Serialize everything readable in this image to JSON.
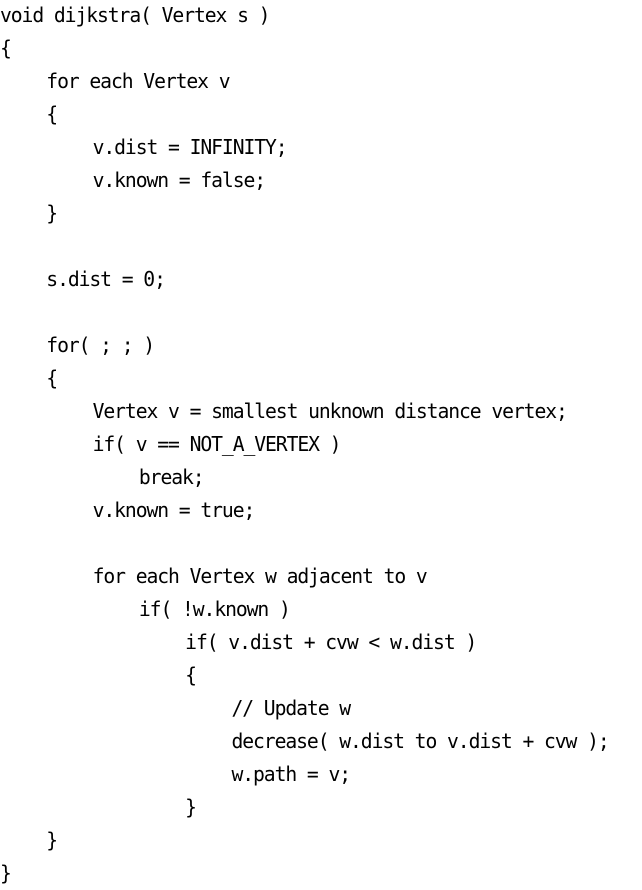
{
  "code": {
    "lines": [
      {
        "indent": 0,
        "text": "void dijkstra( Vertex s )"
      },
      {
        "indent": 0,
        "text": "{"
      },
      {
        "indent": 1,
        "text": "for each Vertex v"
      },
      {
        "indent": 1,
        "text": "{"
      },
      {
        "indent": 2,
        "text": "v.dist = INFINITY;"
      },
      {
        "indent": 2,
        "text": "v.known = false;"
      },
      {
        "indent": 1,
        "text": "}"
      },
      {
        "indent": 0,
        "text": ""
      },
      {
        "indent": 1,
        "text": "s.dist = 0;"
      },
      {
        "indent": 0,
        "text": ""
      },
      {
        "indent": 1,
        "text": "for( ; ; )"
      },
      {
        "indent": 1,
        "text": "{"
      },
      {
        "indent": 2,
        "text": "Vertex v = smallest unknown distance vertex;"
      },
      {
        "indent": 2,
        "text": "if( v == NOT_A_VERTEX )"
      },
      {
        "indent": 3,
        "text": "break;"
      },
      {
        "indent": 2,
        "text": "v.known = true;"
      },
      {
        "indent": 0,
        "text": ""
      },
      {
        "indent": 2,
        "text": "for each Vertex w adjacent to v"
      },
      {
        "indent": 3,
        "text": "if( !w.known )"
      },
      {
        "indent": 4,
        "text": "if( v.dist + cvw < w.dist )"
      },
      {
        "indent": 4,
        "text": "{"
      },
      {
        "indent": 5,
        "text": "// Update w"
      },
      {
        "indent": 5,
        "text": "decrease( w.dist to v.dist + cvw );"
      },
      {
        "indent": 5,
        "text": "w.path = v;"
      },
      {
        "indent": 4,
        "text": "}"
      },
      {
        "indent": 1,
        "text": "}"
      },
      {
        "indent": 0,
        "text": "}"
      }
    ]
  }
}
